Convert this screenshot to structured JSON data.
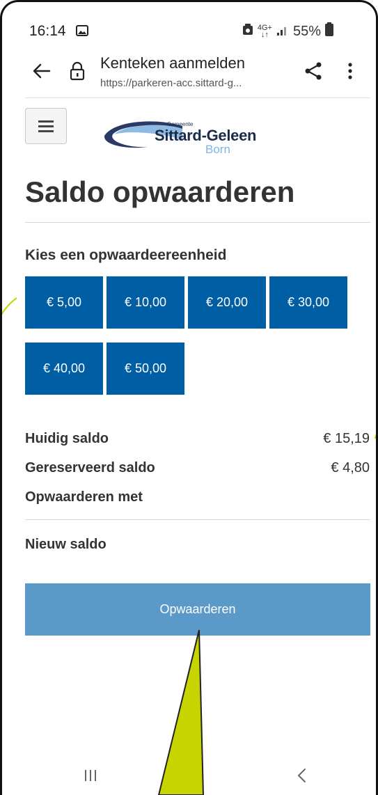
{
  "status_bar": {
    "time": "16:14",
    "network": "4G+",
    "battery": "55%"
  },
  "browser": {
    "title": "Kenteken aanmelden",
    "url": "https://parkeren-acc.sittard-g..."
  },
  "logo": {
    "small_text": "Gemeente",
    "name": "Sittard-Geleen",
    "sub": "Born"
  },
  "page": {
    "title": "Saldo opwaarderen",
    "choose_label": "Kies een opwaardeereenheid",
    "amounts": [
      "€ 5,00",
      "€ 10,00",
      "€ 20,00",
      "€ 30,00",
      "€ 40,00",
      "€ 50,00"
    ],
    "current_balance_label": "Huidig saldo",
    "current_balance_value": "€ 15,19",
    "reserved_label": "Gereserveerd saldo",
    "reserved_value": "€ 4,80",
    "topup_with_label": "Opwaarderen met",
    "new_balance_label": "Nieuw saldo",
    "submit_label": "Opwaarderen"
  },
  "colors": {
    "primary": "#005ea5",
    "submit": "#5b99c8",
    "annotation": "#c8d400"
  }
}
